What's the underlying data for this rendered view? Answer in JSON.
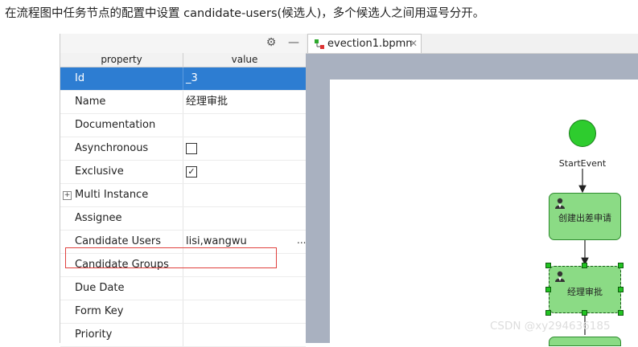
{
  "caption": "在流程图中任务节点的配置中设置 candidate-users(候选人)，多个候选人之间用逗号分开。",
  "toolbar": {
    "gear_icon": "gear-icon",
    "minimize_icon": "minimize-icon"
  },
  "properties": {
    "headers": {
      "property": "property",
      "value": "value"
    },
    "rows": [
      {
        "name": "Id",
        "value": "_3",
        "selected": true
      },
      {
        "name": "Name",
        "value": "经理审批"
      },
      {
        "name": "Documentation",
        "value": ""
      },
      {
        "name": "Asynchronous",
        "value": "",
        "checkbox": false
      },
      {
        "name": "Exclusive",
        "value": "",
        "checkbox": true
      },
      {
        "name": "Multi Instance",
        "value": "",
        "expandable": true
      },
      {
        "name": "Assignee",
        "value": ""
      },
      {
        "name": "Candidate Users",
        "value": "lisi,wangwu",
        "ellipsis": "...",
        "highlighted": true
      },
      {
        "name": "Candidate Groups",
        "value": ""
      },
      {
        "name": "Due Date",
        "value": ""
      },
      {
        "name": "Form Key",
        "value": ""
      },
      {
        "name": "Priority",
        "value": ""
      }
    ]
  },
  "editor": {
    "tab": {
      "label": "evection1.bpmn",
      "close": "✕"
    },
    "diagram": {
      "start_event_label": "StartEvent",
      "task1_label": "创建出差申请",
      "task2_label": "经理审批"
    }
  },
  "colors": {
    "selection": "#2d7dd2",
    "highlight_box": "#e0413e",
    "task_fill": "#8bdb85",
    "start_event": "#2ecc2e",
    "canvas_bg": "#a9b1c0"
  },
  "watermark": "CSDN @xy294636185"
}
